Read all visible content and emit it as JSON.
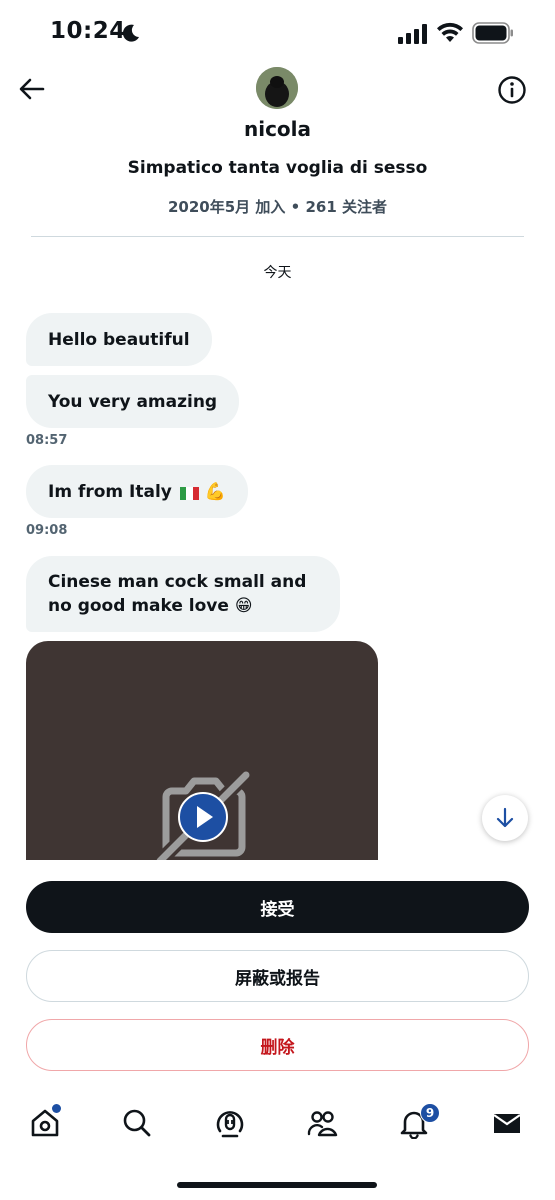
{
  "status_bar": {
    "time": "10:24"
  },
  "profile": {
    "name": "nicola",
    "bio": "Simpatico tanta voglia di sesso",
    "meta": "2020年5月 加入 • 261 关注者"
  },
  "conversation": {
    "day_label": "今天",
    "messages": [
      {
        "text": "Hello beautiful"
      },
      {
        "text": "You very amazing"
      },
      {
        "text": "Im from Italy"
      },
      {
        "text": "Cinese man cock small and no good make love 😁"
      }
    ],
    "emoji_muscle": "💪",
    "times": [
      "08:57",
      "09:08"
    ]
  },
  "actions": {
    "accept_label": "接受",
    "block_report_label": "屏蔽或报告",
    "delete_label": "删除"
  },
  "tab_bar": {
    "notification_count": "9",
    "items": [
      "home-icon",
      "search-icon",
      "spaces-icon",
      "communities-icon",
      "notifications-icon",
      "messages-icon"
    ]
  },
  "colors": {
    "accent": "#1d4fa3",
    "danger": "#c4161c",
    "bubble": "#eff3f4",
    "media_bg": "#3f3533"
  }
}
